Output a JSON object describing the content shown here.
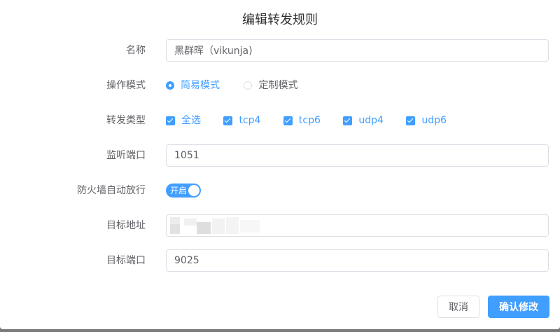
{
  "dialog": {
    "title": "编辑转发规则",
    "fields": {
      "name": {
        "label": "名称",
        "value": "黑群晖（vikunja)"
      },
      "mode": {
        "label": "操作模式",
        "options": [
          "简易模式",
          "定制模式"
        ],
        "selected": "简易模式"
      },
      "types": {
        "label": "转发类型",
        "options": [
          "全选",
          "tcp4",
          "tcp6",
          "udp4",
          "udp6"
        ]
      },
      "listen_port": {
        "label": "监听端口",
        "value": "1051"
      },
      "firewall": {
        "label": "防火墙自动放行",
        "switch_text": "开启",
        "on": true
      },
      "target_addr": {
        "label": "目标地址",
        "value": ""
      },
      "target_port": {
        "label": "目标端口",
        "value": "9025"
      }
    },
    "buttons": {
      "cancel": "取消",
      "confirm": "确认修改"
    }
  },
  "colors": {
    "primary": "#409eff",
    "border": "#dcdfe6",
    "text": "#606266"
  }
}
